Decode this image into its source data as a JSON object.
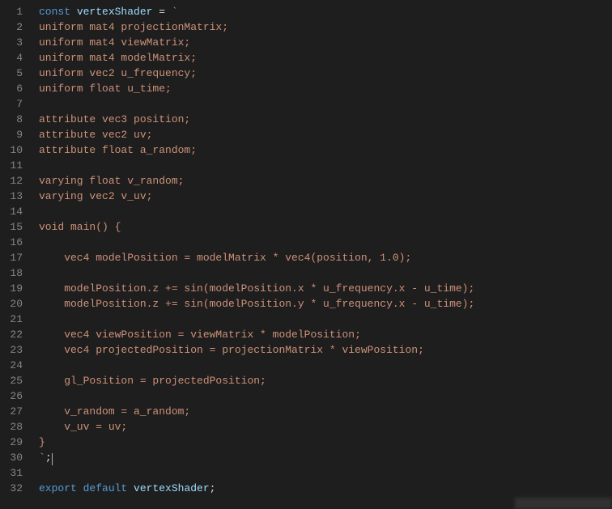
{
  "lines": [
    {
      "num": "1",
      "tokens": [
        [
          "kw",
          "const"
        ],
        [
          "pln",
          " "
        ],
        [
          "var",
          "vertexShader"
        ],
        [
          "pln",
          " "
        ],
        [
          "op",
          "="
        ],
        [
          "pln",
          " "
        ],
        [
          "str",
          "`"
        ]
      ]
    },
    {
      "num": "2",
      "tokens": [
        [
          "str",
          "uniform mat4 projectionMatrix;"
        ]
      ]
    },
    {
      "num": "3",
      "tokens": [
        [
          "str",
          "uniform mat4 viewMatrix;"
        ]
      ]
    },
    {
      "num": "4",
      "tokens": [
        [
          "str",
          "uniform mat4 modelMatrix;"
        ]
      ]
    },
    {
      "num": "5",
      "tokens": [
        [
          "str",
          "uniform vec2 u_frequency;"
        ]
      ]
    },
    {
      "num": "6",
      "tokens": [
        [
          "str",
          "uniform float u_time;"
        ]
      ]
    },
    {
      "num": "7",
      "tokens": []
    },
    {
      "num": "8",
      "tokens": [
        [
          "str",
          "attribute vec3 position;"
        ]
      ]
    },
    {
      "num": "9",
      "tokens": [
        [
          "str",
          "attribute vec2 uv;"
        ]
      ]
    },
    {
      "num": "10",
      "tokens": [
        [
          "str",
          "attribute float a_random;"
        ]
      ]
    },
    {
      "num": "11",
      "tokens": []
    },
    {
      "num": "12",
      "tokens": [
        [
          "str",
          "varying float v_random;"
        ]
      ]
    },
    {
      "num": "13",
      "tokens": [
        [
          "str",
          "varying vec2 v_uv;"
        ]
      ]
    },
    {
      "num": "14",
      "tokens": []
    },
    {
      "num": "15",
      "tokens": [
        [
          "str",
          "void main() {"
        ]
      ]
    },
    {
      "num": "16",
      "tokens": []
    },
    {
      "num": "17",
      "tokens": [
        [
          "str",
          "    vec4 modelPosition = modelMatrix * vec4(position, 1.0);"
        ]
      ]
    },
    {
      "num": "18",
      "tokens": []
    },
    {
      "num": "19",
      "tokens": [
        [
          "str",
          "    modelPosition.z += sin(modelPosition.x * u_frequency.x - u_time);"
        ]
      ]
    },
    {
      "num": "20",
      "tokens": [
        [
          "str",
          "    modelPosition.z += sin(modelPosition.y * u_frequency.x - u_time);"
        ]
      ]
    },
    {
      "num": "21",
      "tokens": []
    },
    {
      "num": "22",
      "tokens": [
        [
          "str",
          "    vec4 viewPosition = viewMatrix * modelPosition;"
        ]
      ]
    },
    {
      "num": "23",
      "tokens": [
        [
          "str",
          "    vec4 projectedPosition = projectionMatrix * viewPosition;"
        ]
      ]
    },
    {
      "num": "24",
      "tokens": []
    },
    {
      "num": "25",
      "tokens": [
        [
          "str",
          "    gl_Position = projectedPosition;"
        ]
      ]
    },
    {
      "num": "26",
      "tokens": []
    },
    {
      "num": "27",
      "tokens": [
        [
          "str",
          "    v_random = a_random;"
        ]
      ]
    },
    {
      "num": "28",
      "tokens": [
        [
          "str",
          "    v_uv = uv;"
        ]
      ]
    },
    {
      "num": "29",
      "tokens": [
        [
          "str",
          "}"
        ]
      ]
    },
    {
      "num": "30",
      "tokens": [
        [
          "str",
          "`"
        ],
        [
          "pln",
          ";"
        ]
      ],
      "cursor": true
    },
    {
      "num": "31",
      "tokens": []
    },
    {
      "num": "32",
      "tokens": [
        [
          "kw",
          "export"
        ],
        [
          "pln",
          " "
        ],
        [
          "kw",
          "default"
        ],
        [
          "pln",
          " "
        ],
        [
          "var",
          "vertexShader"
        ],
        [
          "pln",
          ";"
        ]
      ]
    }
  ]
}
